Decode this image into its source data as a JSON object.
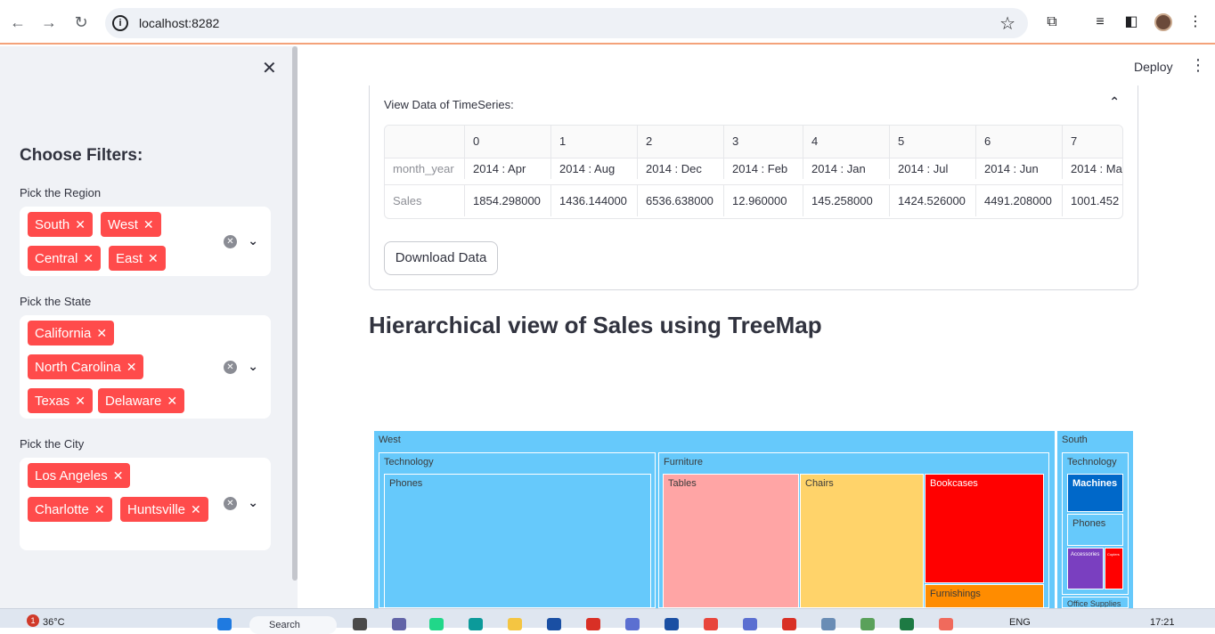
{
  "browser": {
    "url": "localhost:8282"
  },
  "app": {
    "deploy_label": "Deploy"
  },
  "sidebar": {
    "title": "Choose Filters:",
    "region": {
      "label": "Pick the Region",
      "tags": [
        "South",
        "West",
        "Central",
        "East"
      ]
    },
    "state": {
      "label": "Pick the State",
      "tags": [
        "California",
        "North Carolina",
        "Texas",
        "Delaware"
      ]
    },
    "city": {
      "label": "Pick the City",
      "tags": [
        "Los Angeles",
        "Charlotte",
        "Huntsville"
      ]
    }
  },
  "expander": {
    "title": "View Data of TimeSeries:",
    "columns": [
      "",
      "0",
      "1",
      "2",
      "3",
      "4",
      "5",
      "6",
      "7"
    ],
    "rows": [
      {
        "label": "month_year",
        "values": [
          "2014 : Apr",
          "2014 : Aug",
          "2014 : Dec",
          "2014 : Feb",
          "2014 : Jan",
          "2014 : Jul",
          "2014 : Jun",
          "2014 : Ma"
        ]
      },
      {
        "label": "Sales",
        "values": [
          "1854.298000",
          "1436.144000",
          "6536.638000",
          "12.960000",
          "145.258000",
          "1424.526000",
          "4491.208000",
          "1001.452"
        ]
      }
    ],
    "download_label": "Download Data"
  },
  "treemap_heading": "Hierarchical view of Sales using TreeMap",
  "treemap": {
    "labels": {
      "west": "West",
      "west_technology": "Technology",
      "west_phones": "Phones",
      "west_furniture": "Furniture",
      "west_tables": "Tables",
      "west_chairs": "Chairs",
      "west_bookcases": "Bookcases",
      "west_furnishings": "Furnishings",
      "south": "South",
      "south_technology": "Technology",
      "south_machines": "Machines",
      "south_phones": "Phones",
      "south_accessories": "Accessories",
      "south_copiers": "Copiers",
      "south_office": "Office Supplies"
    },
    "colors": {
      "base": "#66c9fb",
      "tables": "#ffa5a5",
      "chairs": "#ffd36a",
      "bookcases": "#ff0000",
      "furnishings": "#ff8c00",
      "machines": "#0068c9",
      "accessories": "#7a3fc0",
      "copiers": "#ff0000"
    }
  },
  "taskbar": {
    "weather_badge": "1",
    "temperature": "36°C",
    "search": "Search",
    "language": "ENG",
    "time": "17:21"
  }
}
